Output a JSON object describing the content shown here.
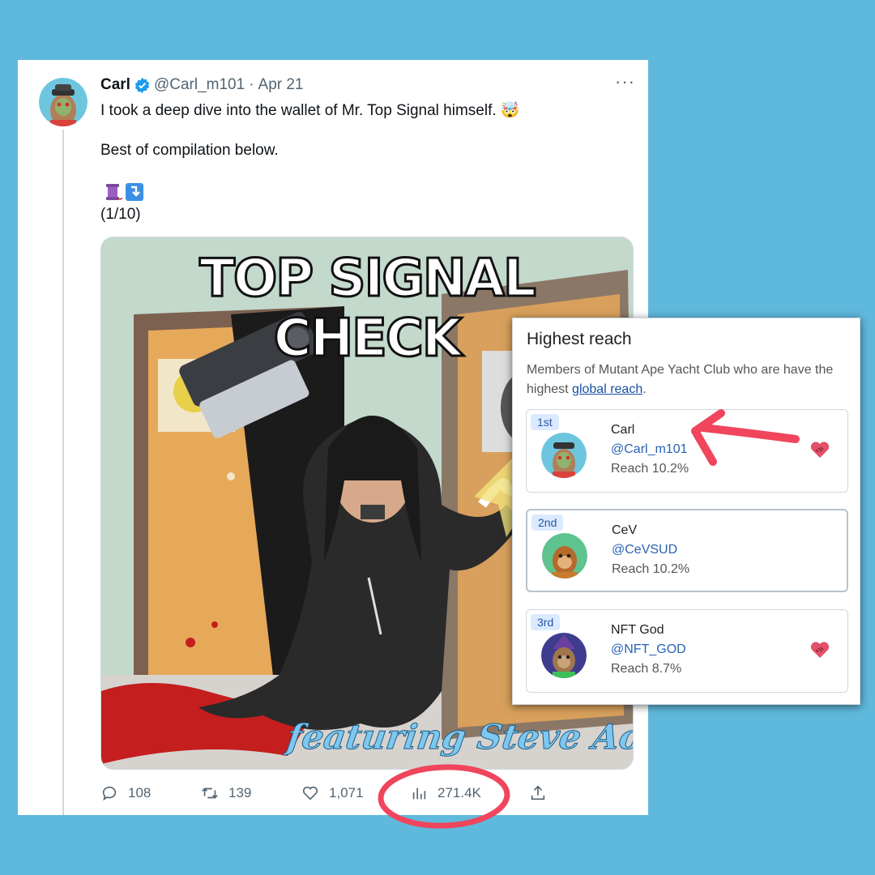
{
  "tweet": {
    "author_name": "Carl",
    "handle": "@Carl_m101",
    "separator": "·",
    "date": "Apr 21",
    "more_label": "···",
    "text_line1": "I took a deep dive into the wallet of Mr. Top Signal himself. 🤯",
    "text_line2": "Best of compilation below.",
    "text_line3": "🧵⤵️",
    "text_line4": "(1/10)",
    "media": {
      "title": "TOP SIGNAL CHECK",
      "caption": "featuring Steve Aoki"
    },
    "actions": {
      "replies": "108",
      "retweets": "139",
      "likes": "1,071",
      "views": "271.4K"
    }
  },
  "reach_panel": {
    "title": "Highest reach",
    "desc_prefix": "Members of Mutant Ape Yacht Club who are have the highest ",
    "desc_link": "global reach",
    "desc_suffix": ".",
    "members": [
      {
        "rank": "1st",
        "name": "Carl",
        "handle": "@Carl_m101",
        "reach": "Reach 10.2%"
      },
      {
        "rank": "2nd",
        "name": "CeV",
        "handle": "@CeVSUD",
        "reach": "Reach 10.2%"
      },
      {
        "rank": "3rd",
        "name": "NFT God",
        "handle": "@NFT_GOD",
        "reach": "Reach 8.7%"
      }
    ]
  },
  "colors": {
    "background": "#5fb9dc",
    "annotation": "#f0455c",
    "link": "#2a62b3",
    "verified": "#1d9bf0"
  },
  "icons": [
    "verified-badge-icon",
    "more-icon",
    "reply-icon",
    "retweet-icon",
    "like-icon",
    "views-icon",
    "share-icon",
    "handshake-heart-icon"
  ]
}
